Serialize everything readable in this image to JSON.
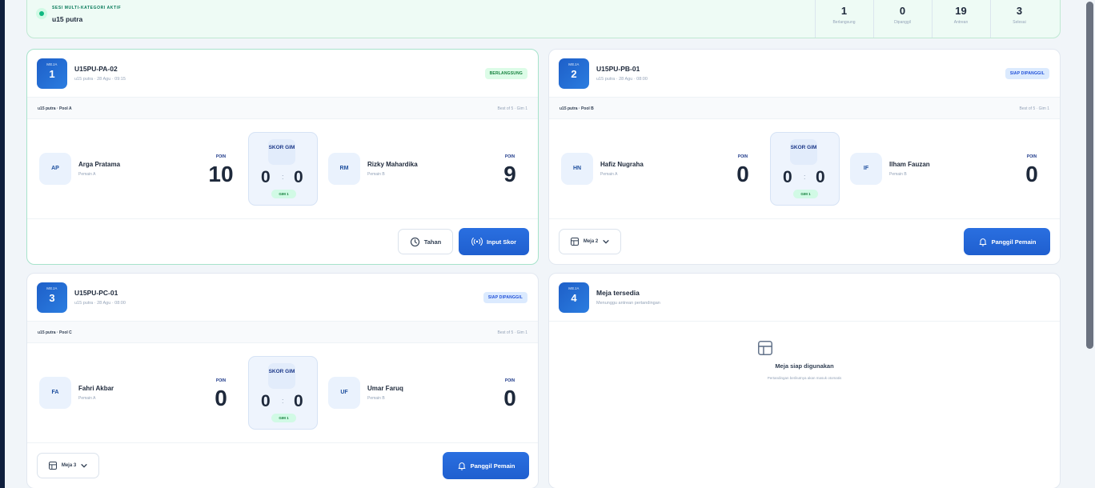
{
  "session": {
    "eyebrow": "SESI MULTI-KATEGORI AKTIF",
    "name": "u15 putra",
    "stats": [
      {
        "value": "1",
        "label": "Berlangsung"
      },
      {
        "value": "0",
        "label": "Dipanggil"
      },
      {
        "value": "19",
        "label": "Antrean"
      },
      {
        "value": "3",
        "label": "Selesai"
      }
    ]
  },
  "table_label": "MEJA",
  "poin_label": "POIN",
  "skor_label": "SKOR GIM",
  "courts": [
    {
      "number": "1",
      "code": "U15PU-PA-02",
      "meta": "u15 putra · 28 Agu · 09:15",
      "status": "BERLANGSUNG",
      "pool": "u15 putra · Pool A",
      "best_of": "Best of 5 · Gim 1",
      "player_a": {
        "initials": "AP",
        "name": "Arga Pratama",
        "side": "Pemain A",
        "points": "10",
        "games": "0"
      },
      "player_b": {
        "initials": "RM",
        "name": "Rizky Mahardika",
        "side": "Pemain B",
        "points": "9",
        "games": "0"
      },
      "gim": "GIM 1",
      "hold_label": "Tahan",
      "input_label": "Input Skor"
    },
    {
      "number": "2",
      "code": "U15PU-PB-01",
      "meta": "u15 putra · 28 Agu · 08:00",
      "status": "SIAP DIPANGGIL",
      "pool": "u15 putra · Pool B",
      "best_of": "Best of 5 · Gim 1",
      "player_a": {
        "initials": "HN",
        "name": "Hafiz Nugraha",
        "side": "Pemain A",
        "points": "0",
        "games": "0"
      },
      "player_b": {
        "initials": "IF",
        "name": "Ilham Fauzan",
        "side": "Pemain B",
        "points": "0",
        "games": "0"
      },
      "gim": "GIM 1",
      "table_select": "Meja 2",
      "call_label": "Panggil Pemain"
    },
    {
      "number": "3",
      "code": "U15PU-PC-01",
      "meta": "u15 putra · 28 Agu · 08:00",
      "status": "SIAP DIPANGGIL",
      "pool": "u15 putra · Pool C",
      "best_of": "Best of 5 · Gim 1",
      "player_a": {
        "initials": "FA",
        "name": "Fahri Akbar",
        "side": "Pemain A",
        "points": "0",
        "games": "0"
      },
      "player_b": {
        "initials": "UF",
        "name": "Umar Faruq",
        "side": "Pemain B",
        "points": "0",
        "games": "0"
      },
      "gim": "GIM 1",
      "table_select": "Meja 3",
      "call_label": "Panggil Pemain"
    }
  ],
  "empty_court": {
    "number": "4",
    "title": "Meja tersedia",
    "subtitle": "Menunggu antrean pertandingan",
    "empty_title": "Meja siap digunakan",
    "empty_sub": "Pertandingan berikutnya akan masuk otomatis"
  },
  "colors": {
    "primary": "#1f5fcf",
    "success": "#10b981",
    "sidebar": "#0f1f3d"
  }
}
